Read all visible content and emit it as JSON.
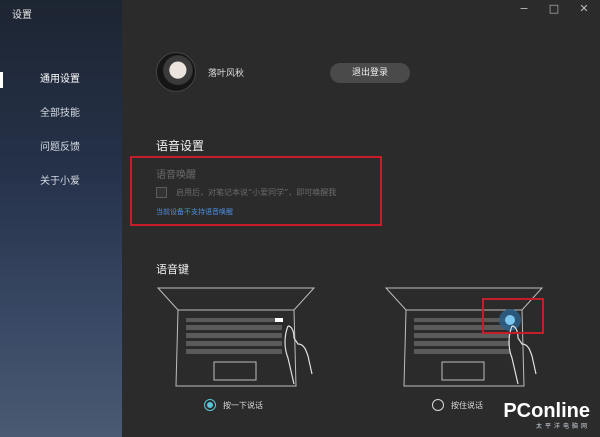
{
  "app": {
    "title": "设置"
  },
  "window_controls": {
    "minimize": "−",
    "maximize": "□",
    "close": "✕"
  },
  "sidebar": {
    "items": [
      {
        "label": "通用设置",
        "active": true
      },
      {
        "label": "全部技能",
        "active": false
      },
      {
        "label": "问题反馈",
        "active": false
      },
      {
        "label": "关于小爱",
        "active": false
      }
    ]
  },
  "profile": {
    "username": "落叶风秋",
    "logout_label": "退出登录"
  },
  "voice_settings": {
    "title": "语音设置",
    "wake": {
      "title": "语音唤醒",
      "description": "启用后，对笔记本说“小爱同学”，即可唤醒我",
      "checked": false,
      "note": "当前设备不支持语音唤醒"
    }
  },
  "voice_key": {
    "title": "语音键",
    "options": [
      {
        "label": "按一下说话",
        "selected": true
      },
      {
        "label": "按住说话",
        "selected": false
      }
    ]
  },
  "watermark": {
    "brand": "PConline",
    "sub": "太平洋电脑网"
  },
  "colors": {
    "highlight": "#c81c28",
    "accent": "#5bc4d6",
    "link": "#4a90e2"
  }
}
